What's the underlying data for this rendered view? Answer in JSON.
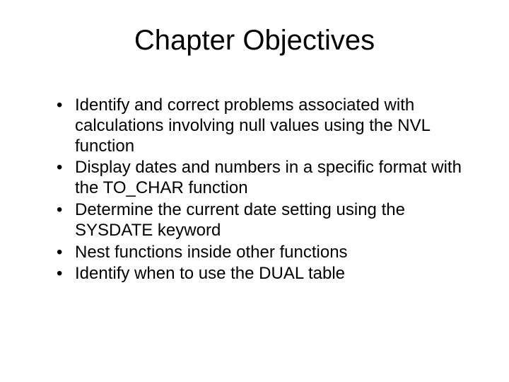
{
  "slide": {
    "title": "Chapter Objectives",
    "bullets": [
      "Identify and correct problems associated with calculations involving null values using the NVL function",
      "Display dates and numbers in a specific format with the TO_CHAR function",
      "Determine the current date setting using the SYSDATE keyword",
      "Nest functions inside other functions",
      "Identify when to use the DUAL table"
    ]
  }
}
